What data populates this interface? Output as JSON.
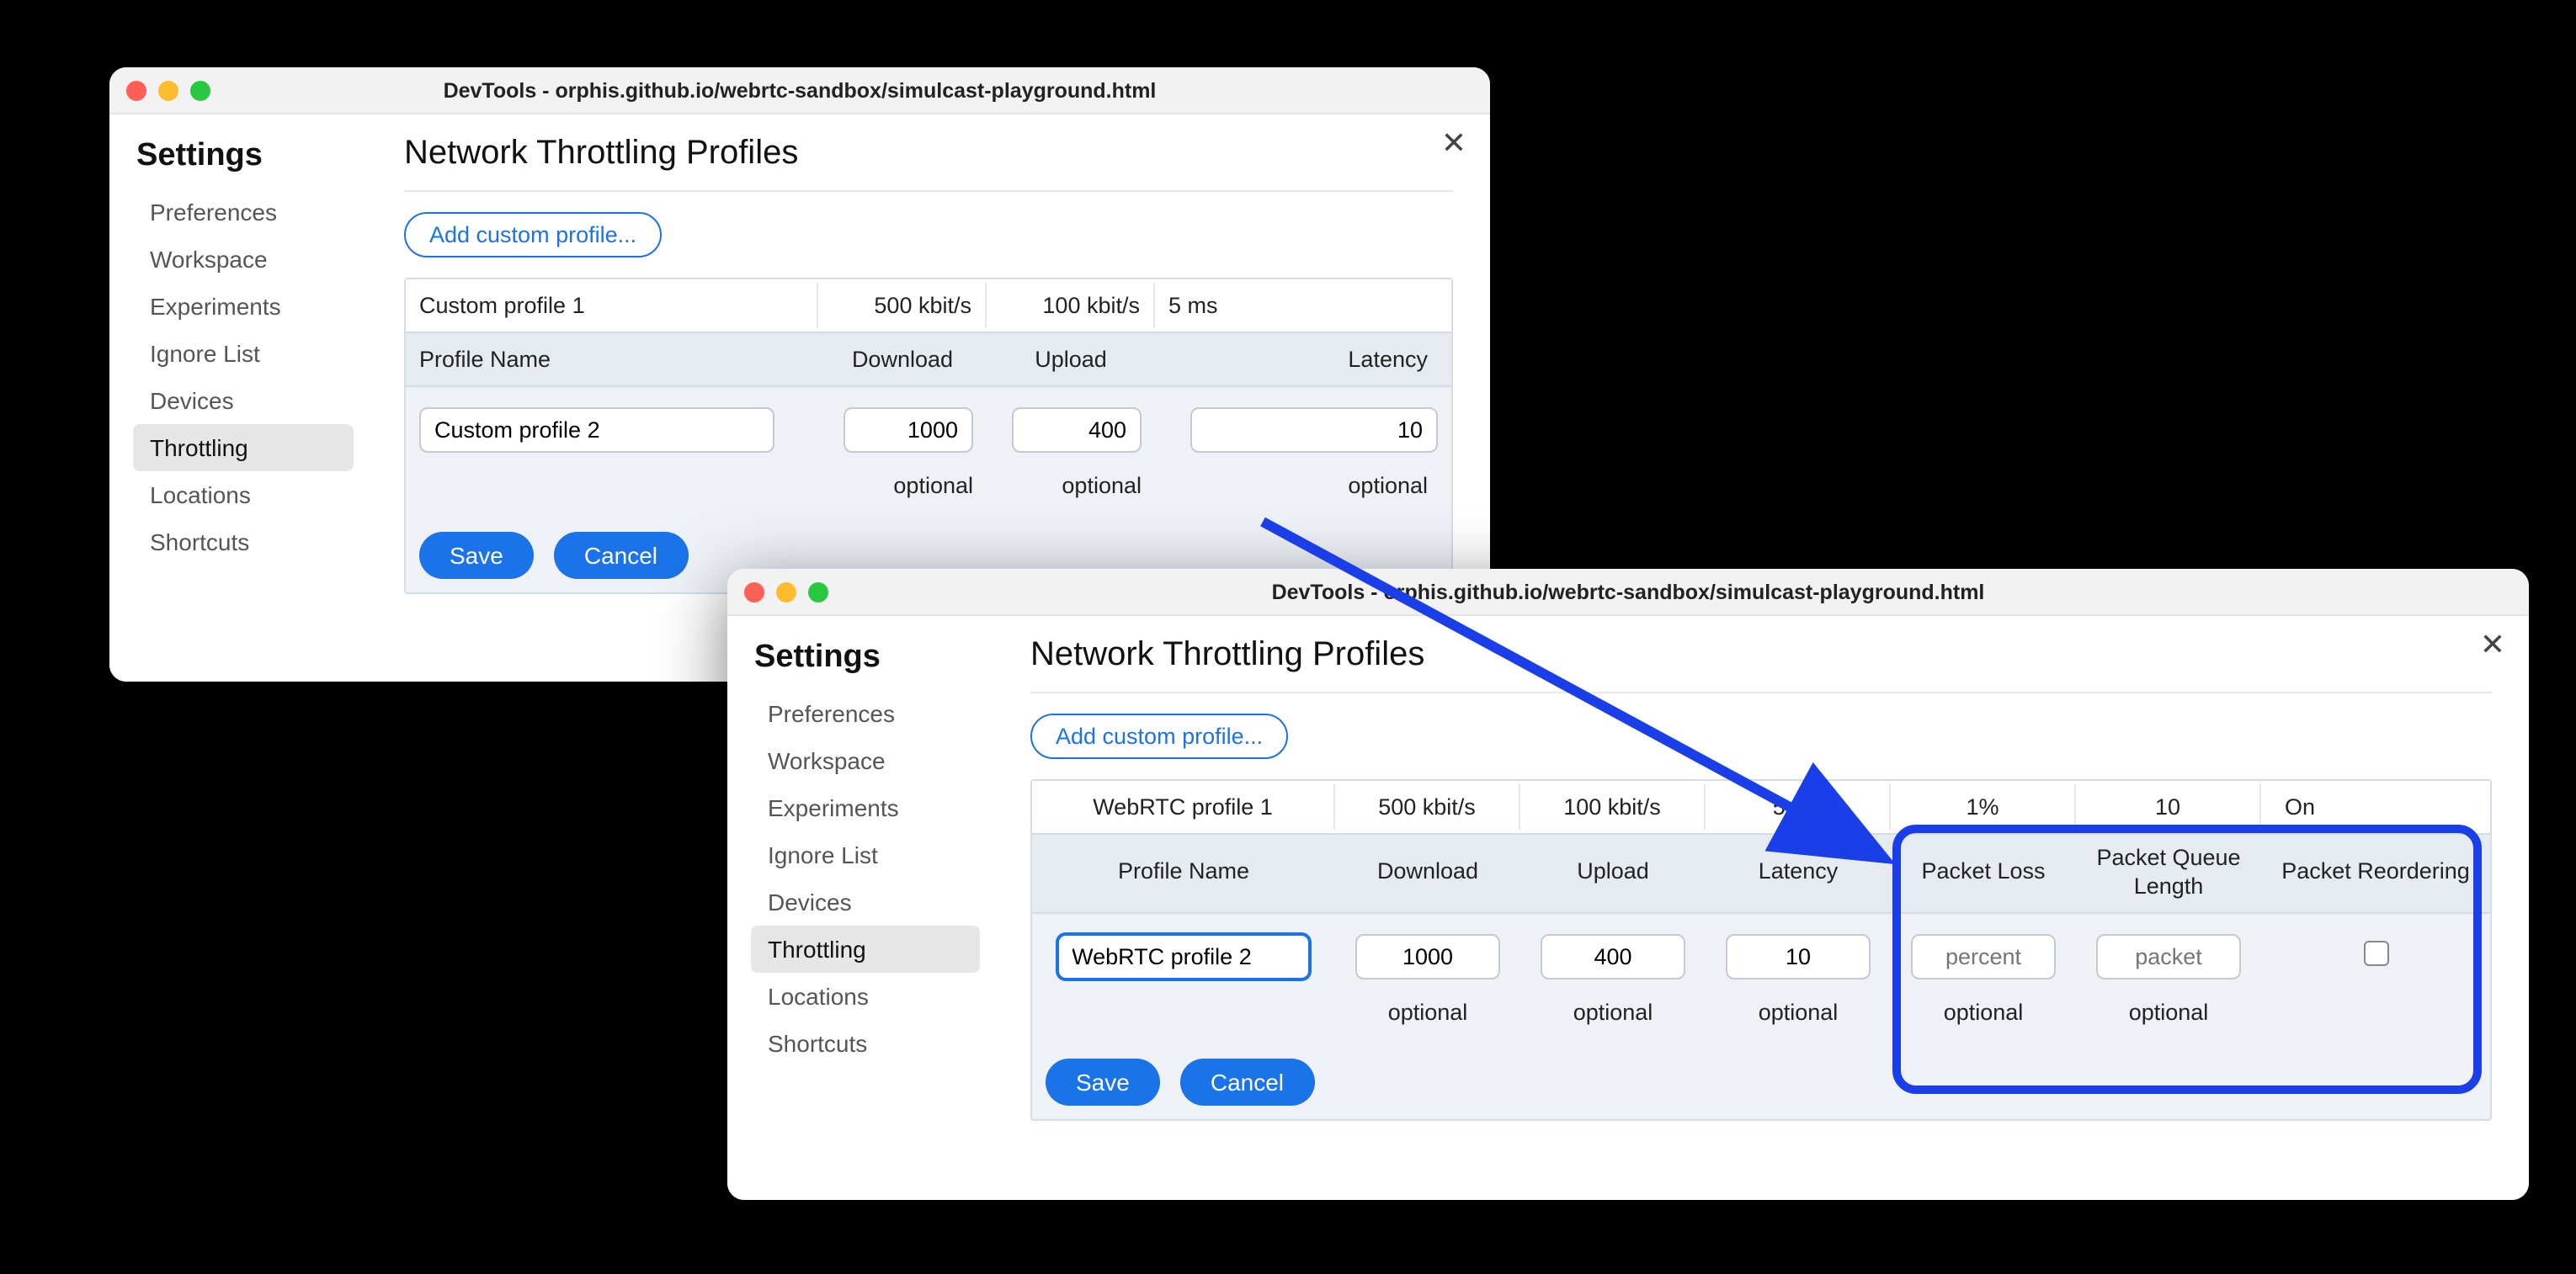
{
  "win1": {
    "title": "DevTools - orphis.github.io/webrtc-sandbox/simulcast-playground.html",
    "sidebar_title": "Settings",
    "sidebar": [
      "Preferences",
      "Workspace",
      "Experiments",
      "Ignore List",
      "Devices",
      "Throttling",
      "Locations",
      "Shortcuts"
    ],
    "active_idx": 5,
    "page_title": "Network Throttling Profiles",
    "add_label": "Add custom profile...",
    "existing": {
      "name": "Custom profile 1",
      "dl": "500 kbit/s",
      "ul": "100 kbit/s",
      "lat": "5 ms"
    },
    "headers": {
      "name": "Profile Name",
      "dl": "Download",
      "ul": "Upload",
      "lat": "Latency"
    },
    "edit": {
      "name": "Custom profile 2",
      "dl": "1000",
      "ul": "400",
      "lat": "10"
    },
    "hint": "optional",
    "save": "Save",
    "cancel": "Cancel"
  },
  "win2": {
    "title": "DevTools - orphis.github.io/webrtc-sandbox/simulcast-playground.html",
    "sidebar_title": "Settings",
    "sidebar": [
      "Preferences",
      "Workspace",
      "Experiments",
      "Ignore List",
      "Devices",
      "Throttling",
      "Locations",
      "Shortcuts"
    ],
    "active_idx": 5,
    "page_title": "Network Throttling Profiles",
    "add_label": "Add custom profile...",
    "existing": {
      "name": "WebRTC profile 1",
      "dl": "500 kbit/s",
      "ul": "100 kbit/s",
      "lat": "5 ms",
      "loss": "1%",
      "q": "10",
      "re": "On"
    },
    "headers": {
      "name": "Profile Name",
      "dl": "Download",
      "ul": "Upload",
      "lat": "Latency",
      "loss": "Packet Loss",
      "q": "Packet Queue Length",
      "re": "Packet Reordering"
    },
    "edit": {
      "name": "WebRTC profile 2",
      "dl": "1000",
      "ul": "400",
      "lat": "10",
      "loss_ph": "percent",
      "q_ph": "packet"
    },
    "hint": "optional",
    "save": "Save",
    "cancel": "Cancel"
  }
}
